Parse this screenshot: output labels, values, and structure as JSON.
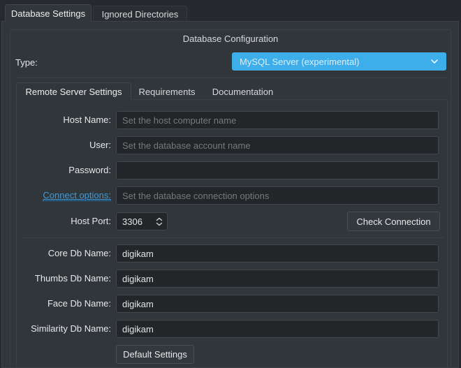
{
  "top_tabs": {
    "database_settings": "Database Settings",
    "ignored_directories": "Ignored Directories"
  },
  "groupbox": {
    "title": "Database Configuration"
  },
  "type_row": {
    "label": "Type:",
    "combo_value": "MySQL Server (experimental)"
  },
  "inner_tabs": {
    "remote_server_settings": "Remote Server Settings",
    "requirements": "Requirements",
    "documentation": "Documentation"
  },
  "fields": {
    "host_name": {
      "label": "Host Name:",
      "placeholder": "Set the host computer name"
    },
    "user": {
      "label": "User:",
      "placeholder": "Set the database account name"
    },
    "password": {
      "label": "Password:"
    },
    "connect_options": {
      "label": "Connect options:",
      "placeholder": "Set the database connection options"
    },
    "host_port": {
      "label": "Host Port:",
      "value": "3306"
    },
    "core_db": {
      "label": "Core Db Name:",
      "value": "digikam"
    },
    "thumbs_db": {
      "label": "Thumbs Db Name:",
      "value": "digikam"
    },
    "face_db": {
      "label": "Face Db Name:",
      "value": "digikam"
    },
    "similarity_db": {
      "label": "Similarity Db Name:",
      "value": "digikam"
    }
  },
  "buttons": {
    "check_connection": "Check Connection",
    "default_settings": "Default Settings"
  },
  "colors": {
    "highlight": "#3daee9",
    "link": "#3f9bd8",
    "window": "#31363b",
    "input_bg": "#232629"
  }
}
